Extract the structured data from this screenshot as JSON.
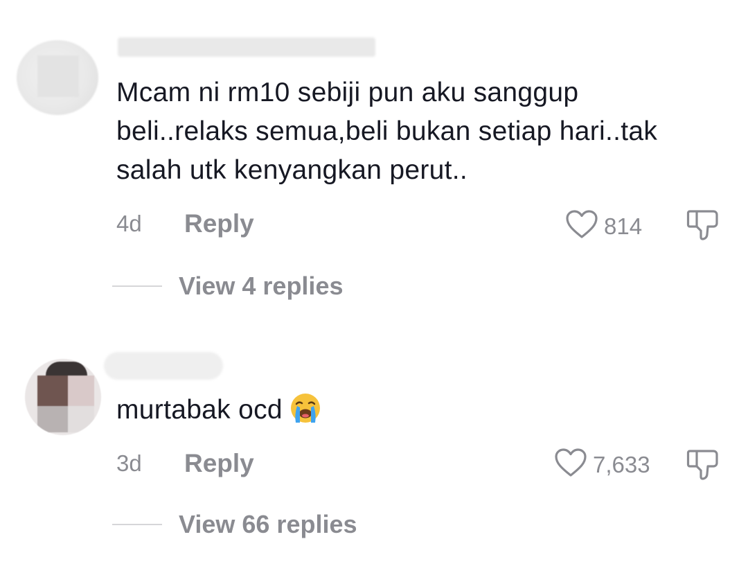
{
  "comments": [
    {
      "text": "Mcam ni rm10 sebiji pun aku sanggup beli..relaks semua,beli bukan setiap hari..tak salah utk kenyangkan perut..",
      "time": "4d",
      "reply_label": "Reply",
      "likes": "814",
      "view_replies": "View 4 replies"
    },
    {
      "text": "murtabak ocd",
      "emoji": "loudly-crying-face",
      "time": "3d",
      "reply_label": "Reply",
      "likes": "7,633",
      "view_replies": "View 66 replies"
    }
  ],
  "colors": {
    "text_primary": "#161823",
    "text_secondary": "#8a8b91",
    "divider": "#d6d6d8"
  },
  "icons": {
    "like": "heart-outline-icon",
    "dislike": "thumbs-down-icon"
  }
}
